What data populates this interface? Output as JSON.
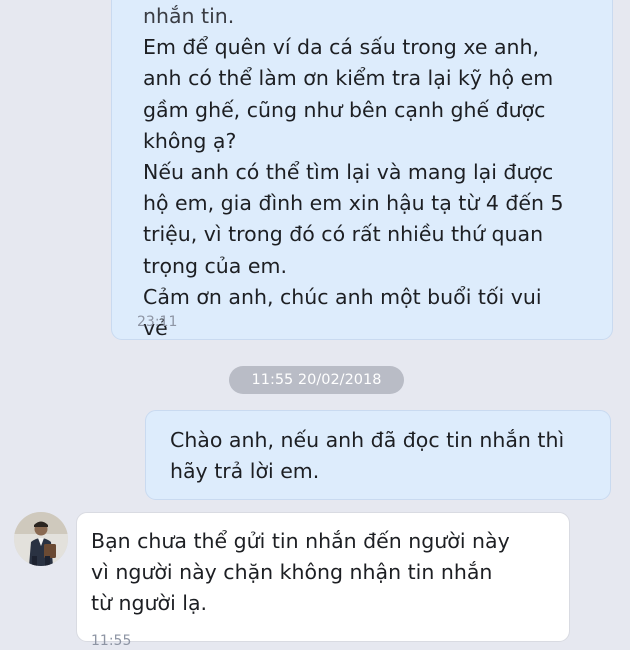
{
  "messages": [
    {
      "direction": "outgoing",
      "partial_line": "nhắn tin.",
      "lines": [
        "Em để quên ví da cá sấu trong xe anh,",
        "anh có thể làm ơn kiểm tra lại kỹ hộ em",
        "gầm ghế, cũng như bên cạnh ghế được",
        "không ạ?",
        "Nếu anh có thể tìm lại và mang lại được",
        "hộ em, gia đình em xin hậu tạ từ 4 đến 5",
        "triệu, vì trong đó có rất nhiều thứ quan",
        "trọng của em.",
        "Cảm ơn anh, chúc anh một buổi tối vui",
        "vẻ"
      ],
      "time": "23:11"
    },
    {
      "direction": "outgoing",
      "lines": [
        "Chào anh, nếu anh đã đọc tin nhắn thì",
        "hãy trả lời em."
      ]
    },
    {
      "direction": "incoming",
      "lines": [
        "Bạn chưa thể gửi tin nhắn đến người này",
        "vì người này chặn không nhận tin nhắn",
        "từ người lạ."
      ],
      "time": "11:55"
    }
  ],
  "date_separator": "11:55 20/02/2018",
  "colors": {
    "background": "#e6e8f0",
    "outgoing_bubble": "#ddecfc",
    "incoming_bubble": "#ffffff",
    "date_pill": "#b9bcc6",
    "timestamp": "#8e95a4"
  }
}
